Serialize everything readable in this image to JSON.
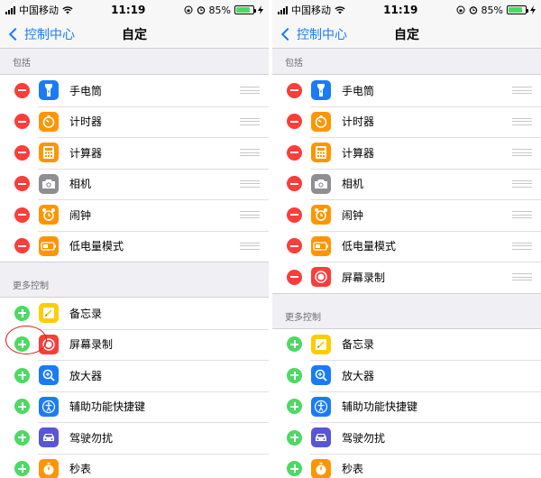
{
  "status": {
    "carrier": "中国移动",
    "time": "11:19",
    "battery": "85%",
    "battery_level": 0.85
  },
  "nav": {
    "back_label": "控制中心",
    "title": "自定"
  },
  "sections": {
    "included": "包括",
    "more": "更多控制"
  },
  "colors": {
    "accent": "#1a7cf5",
    "remove": "#fc3d39",
    "add": "#4cd964"
  },
  "left": {
    "included": [
      {
        "label": "手电筒",
        "icon": "flashlight-icon",
        "color": "#1a7cf5"
      },
      {
        "label": "计时器",
        "icon": "timer-icon",
        "color": "#ff9500"
      },
      {
        "label": "计算器",
        "icon": "calculator-icon",
        "color": "#ff9500"
      },
      {
        "label": "相机",
        "icon": "camera-icon",
        "color": "#8e8e93"
      },
      {
        "label": "闹钟",
        "icon": "alarm-icon",
        "color": "#ff9500"
      },
      {
        "label": "低电量模式",
        "icon": "low-power-icon",
        "color": "#ff9500"
      }
    ],
    "more": [
      {
        "label": "备忘录",
        "icon": "notes-icon",
        "color": "#ffcc00"
      },
      {
        "label": "屏幕录制",
        "icon": "screen-record-icon",
        "color": "#fc3d39"
      },
      {
        "label": "放大器",
        "icon": "magnifier-icon",
        "color": "#1a7cf5"
      },
      {
        "label": "辅助功能快捷键",
        "icon": "accessibility-icon",
        "color": "#1a7cf5"
      },
      {
        "label": "驾驶勿扰",
        "icon": "car-icon",
        "color": "#5856d6"
      },
      {
        "label": "秒表",
        "icon": "stopwatch-icon",
        "color": "#ff9500"
      }
    ]
  },
  "right": {
    "included": [
      {
        "label": "手电筒",
        "icon": "flashlight-icon",
        "color": "#1a7cf5"
      },
      {
        "label": "计时器",
        "icon": "timer-icon",
        "color": "#ff9500"
      },
      {
        "label": "计算器",
        "icon": "calculator-icon",
        "color": "#ff9500"
      },
      {
        "label": "相机",
        "icon": "camera-icon",
        "color": "#8e8e93"
      },
      {
        "label": "闹钟",
        "icon": "alarm-icon",
        "color": "#ff9500"
      },
      {
        "label": "低电量模式",
        "icon": "low-power-icon",
        "color": "#ff9500"
      },
      {
        "label": "屏幕录制",
        "icon": "screen-record-icon",
        "color": "#fc3d39"
      }
    ],
    "more": [
      {
        "label": "备忘录",
        "icon": "notes-icon",
        "color": "#ffcc00"
      },
      {
        "label": "放大器",
        "icon": "magnifier-icon",
        "color": "#1a7cf5"
      },
      {
        "label": "辅助功能快捷键",
        "icon": "accessibility-icon",
        "color": "#1a7cf5"
      },
      {
        "label": "驾驶勿扰",
        "icon": "car-icon",
        "color": "#5856d6"
      },
      {
        "label": "秒表",
        "icon": "stopwatch-icon",
        "color": "#ff9500"
      }
    ]
  }
}
